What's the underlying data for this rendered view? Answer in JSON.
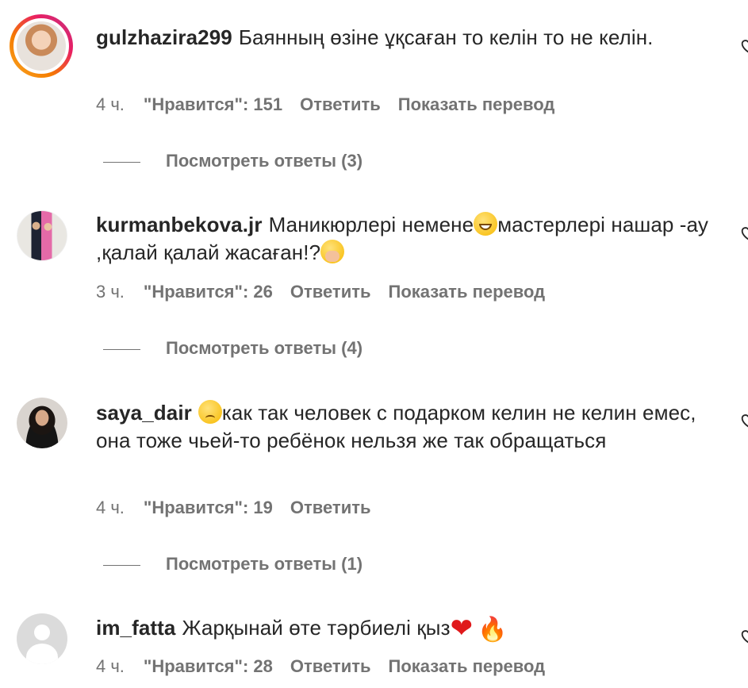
{
  "comments": [
    {
      "username": "gulzhazira299",
      "text": "Баянның өзіне ұқсаған то келін то не келін.",
      "time": "4 ч.",
      "likes": "\"Нравится\": 151",
      "reply": "Ответить",
      "translate": "Показать перевод",
      "view_replies": "Посмотреть ответы (3)",
      "avatar_icon": "user-avatar-story-ring"
    },
    {
      "username": "kurmanbekova.jr",
      "text_part1": "Маникюрлері немене",
      "text_part2": "мастерлері нашар -ау ,қалай қалай жасаған!?",
      "time": "3 ч.",
      "likes": "\"Нравится\": 26",
      "reply": "Ответить",
      "translate": "Показать перевод",
      "view_replies": "Посмотреть ответы (4)",
      "avatar_icon": "user-avatar"
    },
    {
      "username": "saya_dair",
      "text": "как так человек с подарком келин не келин емес, она тоже чьей-то ребёнок нельзя же так обращаться",
      "time": "4 ч.",
      "likes": "\"Нравится\": 19",
      "reply": "Ответить",
      "view_replies": "Посмотреть ответы (1)",
      "avatar_icon": "user-avatar"
    },
    {
      "username": "im_fatta",
      "text": "Жарқынай өте тәрбиелі қыз",
      "time": "4 ч.",
      "likes": "\"Нравится\": 28",
      "reply": "Ответить",
      "translate": "Показать перевод",
      "avatar_icon": "default-avatar"
    }
  ],
  "emoji": {
    "grin": "grinning-face-emoji",
    "blush": "hand-over-mouth-emoji",
    "sad": "slightly-frowning-face-emoji",
    "heart": "❤",
    "fire": "🔥"
  },
  "icons": {
    "like": "heart-outline-icon"
  },
  "colors": {
    "text": "#262626",
    "secondary": "#737373",
    "story_ring_start": "#f9a825",
    "story_ring_end": "#c13584"
  }
}
